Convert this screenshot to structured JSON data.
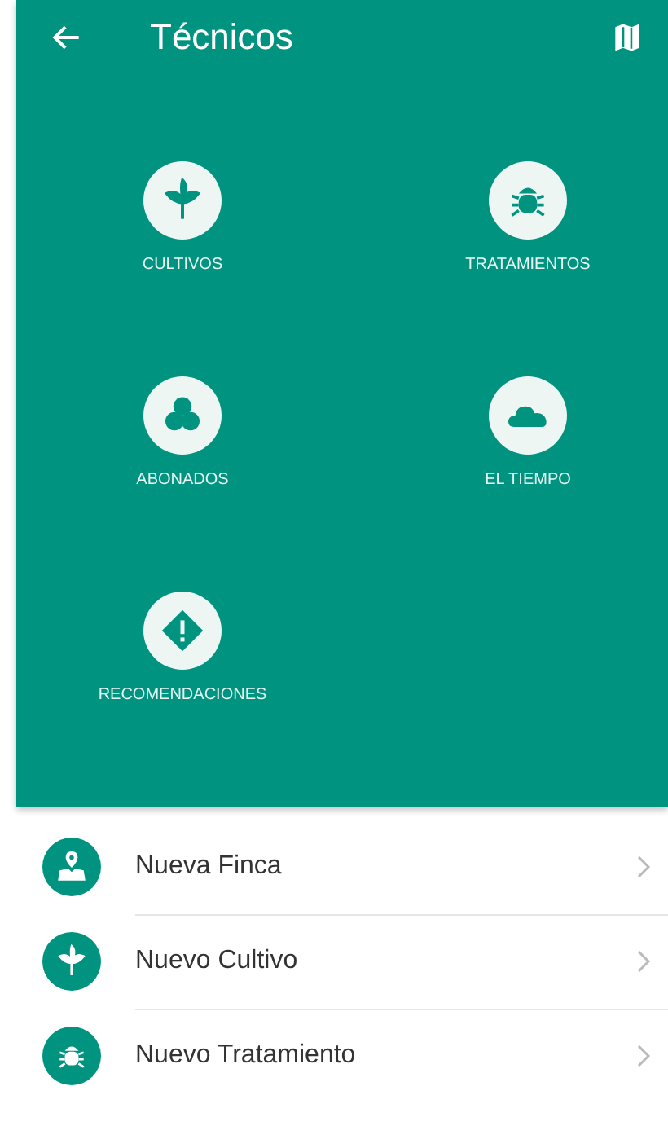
{
  "app_bar": {
    "title": "Técnicos"
  },
  "tiles": [
    {
      "label": "CULTIVOS",
      "kind": "plant"
    },
    {
      "label": "TRATAMIENTOS",
      "kind": "bug"
    },
    {
      "label": "ABONADOS",
      "kind": "circles"
    },
    {
      "label": "EL TIEMPO",
      "kind": "cloud"
    },
    {
      "label": "RECOMENDACIONES",
      "kind": "warning"
    }
  ],
  "list": [
    {
      "label": "Nueva Finca",
      "kind": "map"
    },
    {
      "label": "Nuevo Cultivo",
      "kind": "plant"
    },
    {
      "label": "Nuevo Tratamiento",
      "kind": "bug"
    }
  ]
}
